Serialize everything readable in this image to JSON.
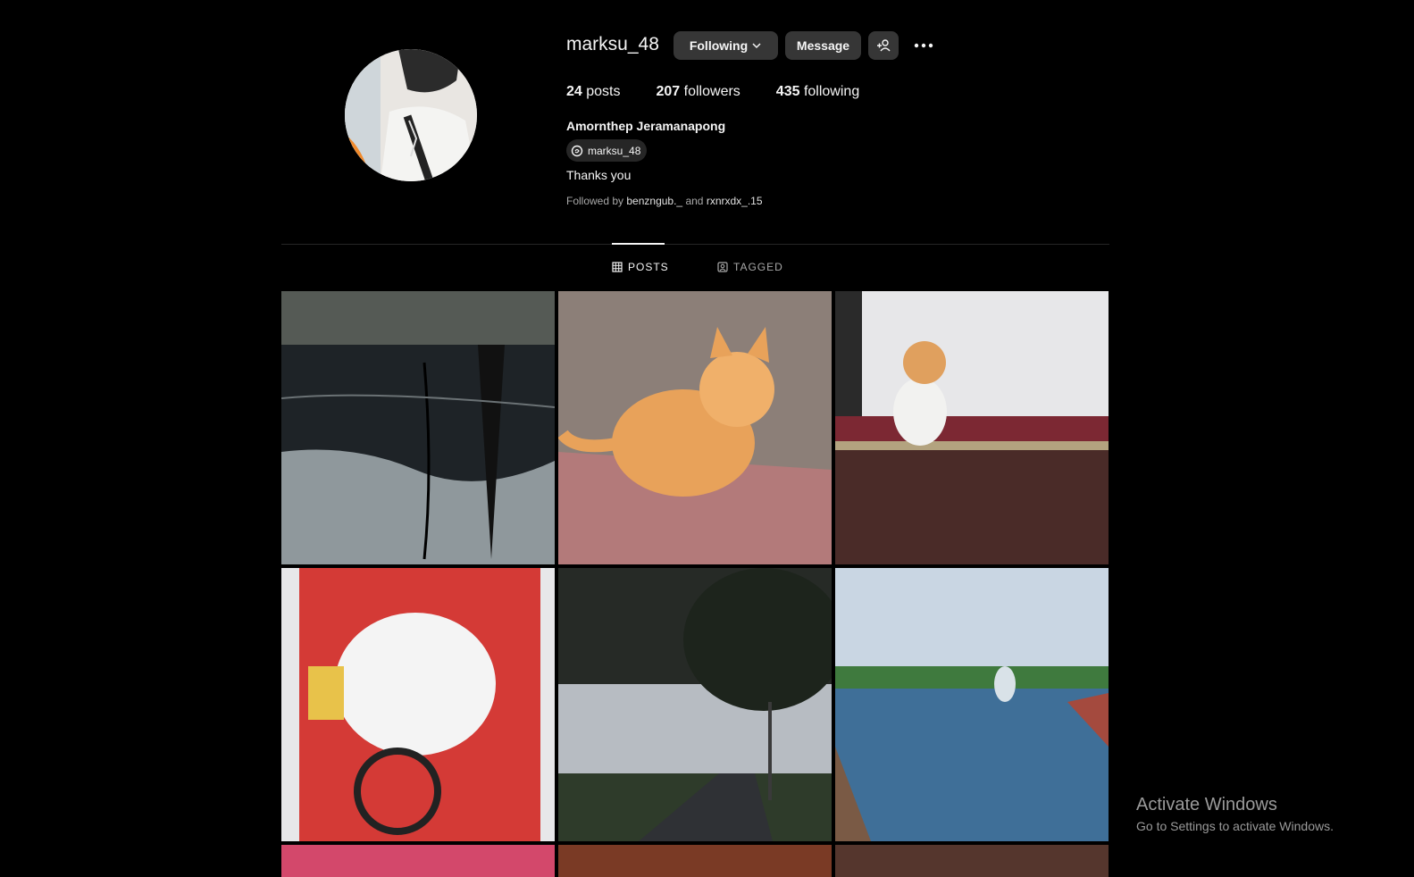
{
  "profile": {
    "username": "marksu_48",
    "buttons": {
      "following": "Following",
      "message": "Message"
    },
    "stats": {
      "posts_count": "24",
      "posts_label": "posts",
      "followers_count": "207",
      "followers_label": "followers",
      "following_count": "435",
      "following_label": "following"
    },
    "full_name": "Amornthep Jeramanapong",
    "threads_handle": "marksu_48",
    "bio": "Thanks you",
    "followed_by": {
      "prefix": "Followed by",
      "user1": "benzngub._",
      "joiner": "and",
      "user2": "rxnrxdx_.15"
    }
  },
  "tabs": [
    {
      "label": "POSTS",
      "active": true,
      "icon": "grid-icon"
    },
    {
      "label": "TAGGED",
      "active": false,
      "icon": "tag-portrait-icon"
    }
  ],
  "posts": [
    {
      "subject": "flooded street reflection"
    },
    {
      "subject": "orange cat sitting"
    },
    {
      "subject": "white and orange cat on ledge"
    },
    {
      "subject": "KFC bucket art"
    },
    {
      "subject": "tree-lined road"
    },
    {
      "subject": "park pond with fountain"
    }
  ],
  "system_watermark": {
    "title": "Activate Windows",
    "subtitle": "Go to Settings to activate Windows."
  },
  "colors": {
    "background": "#000000",
    "button": "#363636",
    "text": "#f5f5f5",
    "muted": "#a8a8a8"
  }
}
